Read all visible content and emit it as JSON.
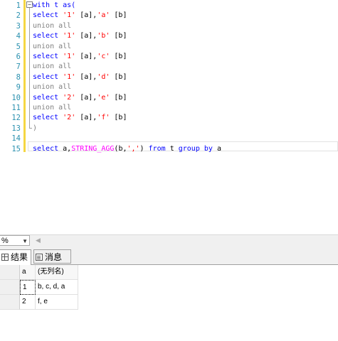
{
  "editor": {
    "line_numbers": [
      "1",
      "2",
      "3",
      "4",
      "5",
      "6",
      "7",
      "8",
      "9",
      "10",
      "11",
      "12",
      "13",
      "14",
      "15"
    ],
    "collapse_glyph": "−",
    "lines": [
      [
        {
          "t": "with t as(",
          "c": "kw"
        }
      ],
      [
        {
          "t": "select ",
          "c": "kw"
        },
        {
          "t": "'1'",
          "c": "str"
        },
        {
          "t": " [a],",
          "c": ""
        },
        {
          "t": "'a'",
          "c": "str"
        },
        {
          "t": " [b]",
          "c": ""
        }
      ],
      [
        {
          "t": "union all",
          "c": "gray"
        }
      ],
      [
        {
          "t": "select ",
          "c": "kw"
        },
        {
          "t": "'1'",
          "c": "str"
        },
        {
          "t": " [a],",
          "c": ""
        },
        {
          "t": "'b'",
          "c": "str"
        },
        {
          "t": " [b]",
          "c": ""
        }
      ],
      [
        {
          "t": "union all",
          "c": "gray"
        }
      ],
      [
        {
          "t": "select ",
          "c": "kw"
        },
        {
          "t": "'1'",
          "c": "str"
        },
        {
          "t": " [a],",
          "c": ""
        },
        {
          "t": "'c'",
          "c": "str"
        },
        {
          "t": " [b]",
          "c": ""
        }
      ],
      [
        {
          "t": "union all",
          "c": "gray"
        }
      ],
      [
        {
          "t": "select ",
          "c": "kw"
        },
        {
          "t": "'1'",
          "c": "str"
        },
        {
          "t": " [a],",
          "c": ""
        },
        {
          "t": "'d'",
          "c": "str"
        },
        {
          "t": " [b]",
          "c": ""
        }
      ],
      [
        {
          "t": "union all",
          "c": "gray"
        }
      ],
      [
        {
          "t": "select ",
          "c": "kw"
        },
        {
          "t": "'2'",
          "c": "str"
        },
        {
          "t": " [a],",
          "c": ""
        },
        {
          "t": "'e'",
          "c": "str"
        },
        {
          "t": " [b]",
          "c": ""
        }
      ],
      [
        {
          "t": "union all",
          "c": "gray"
        }
      ],
      [
        {
          "t": "select ",
          "c": "kw"
        },
        {
          "t": "'2'",
          "c": "str"
        },
        {
          "t": " [a],",
          "c": ""
        },
        {
          "t": "'f'",
          "c": "str"
        },
        {
          "t": " [b]",
          "c": ""
        }
      ],
      [
        {
          "t": ")",
          "c": "gray"
        }
      ],
      [],
      [
        {
          "t": "select ",
          "c": "kw"
        },
        {
          "t": "a,",
          "c": ""
        },
        {
          "t": "STRING_AGG",
          "c": "fn"
        },
        {
          "t": "(b,",
          "c": ""
        },
        {
          "t": "','",
          "c": "str"
        },
        {
          "t": ") ",
          "c": ""
        },
        {
          "t": "from",
          "c": "kw"
        },
        {
          "t": " t ",
          "c": ""
        },
        {
          "t": "group by",
          "c": "kw"
        },
        {
          "t": " a",
          "c": ""
        }
      ]
    ]
  },
  "statusbar": {
    "zoom_value": "%",
    "scroll_arrow": "◀"
  },
  "results_tabs": {
    "results_label": "结果",
    "messages_label": "消息"
  },
  "grid": {
    "columns": [
      "a",
      "(无列名)"
    ],
    "rows": [
      {
        "num": "1",
        "cells": [
          "1",
          "b, c, d, a"
        ]
      },
      {
        "num": "2",
        "cells": [
          "2",
          "f, e"
        ]
      }
    ]
  },
  "colors": {
    "keyword": "#0000ff",
    "string": "#ff0000",
    "function": "#ff00ff",
    "comment_gray": "#808080",
    "line_number": "#2b91af",
    "change_bar": "#f5d642"
  }
}
